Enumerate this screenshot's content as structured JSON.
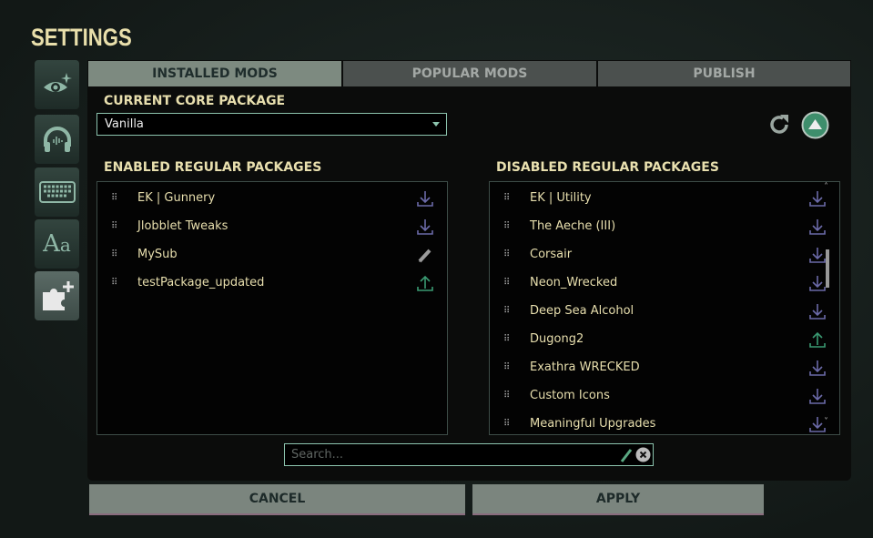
{
  "title": "SETTINGS",
  "sidebar": [
    {
      "icon": "eye-icon"
    },
    {
      "icon": "headphones-icon"
    },
    {
      "icon": "keyboard-icon"
    },
    {
      "icon": "font-icon"
    },
    {
      "icon": "puzzle-plus-icon",
      "active": true
    }
  ],
  "tabs": [
    {
      "label": "INSTALLED MODS",
      "active": true
    },
    {
      "label": "POPULAR MODS"
    },
    {
      "label": "PUBLISH"
    }
  ],
  "core": {
    "label": "CURRENT CORE PACKAGE",
    "value": "Vanilla"
  },
  "enabled": {
    "label": "ENABLED REGULAR PACKAGES",
    "items": [
      {
        "name": "EK | Gunnery",
        "icon": "download"
      },
      {
        "name": "Jlobblet Tweaks",
        "icon": "download"
      },
      {
        "name": "MySub",
        "icon": "edit"
      },
      {
        "name": "testPackage_updated",
        "icon": "upload"
      }
    ]
  },
  "disabled": {
    "label": "DISABLED REGULAR PACKAGES",
    "items": [
      {
        "name": "EK | Utility",
        "icon": "download"
      },
      {
        "name": "The Aeche (III)",
        "icon": "download"
      },
      {
        "name": "Corsair",
        "icon": "download"
      },
      {
        "name": "Neon_Wrecked",
        "icon": "download"
      },
      {
        "name": "Deep Sea Alcohol",
        "icon": "download"
      },
      {
        "name": "Dugong2",
        "icon": "upload"
      },
      {
        "name": "Exathra WRECKED",
        "icon": "download"
      },
      {
        "name": "Custom Icons",
        "icon": "download"
      },
      {
        "name": "Meaningful Upgrades",
        "icon": "download"
      }
    ]
  },
  "search": {
    "placeholder": "Search..."
  },
  "buttons": {
    "cancel": "CANCEL",
    "apply": "APPLY"
  },
  "colors": {
    "accent": "#8cc4ae",
    "text": "#e8dfae",
    "download": "#6b6aa8",
    "upload": "#3a9a72"
  }
}
